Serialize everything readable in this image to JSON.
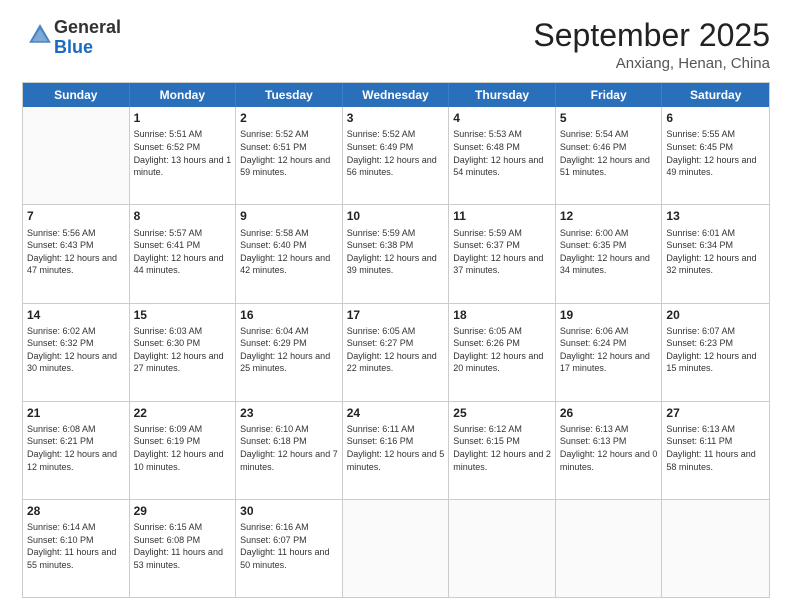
{
  "header": {
    "logo": {
      "line1": "General",
      "line2": "Blue"
    },
    "title": "September 2025",
    "subtitle": "Anxiang, Henan, China"
  },
  "weekdays": [
    "Sunday",
    "Monday",
    "Tuesday",
    "Wednesday",
    "Thursday",
    "Friday",
    "Saturday"
  ],
  "rows": [
    [
      {
        "day": "",
        "empty": true
      },
      {
        "day": "1",
        "sunrise": "Sunrise: 5:51 AM",
        "sunset": "Sunset: 6:52 PM",
        "daylight": "Daylight: 13 hours and 1 minute."
      },
      {
        "day": "2",
        "sunrise": "Sunrise: 5:52 AM",
        "sunset": "Sunset: 6:51 PM",
        "daylight": "Daylight: 12 hours and 59 minutes."
      },
      {
        "day": "3",
        "sunrise": "Sunrise: 5:52 AM",
        "sunset": "Sunset: 6:49 PM",
        "daylight": "Daylight: 12 hours and 56 minutes."
      },
      {
        "day": "4",
        "sunrise": "Sunrise: 5:53 AM",
        "sunset": "Sunset: 6:48 PM",
        "daylight": "Daylight: 12 hours and 54 minutes."
      },
      {
        "day": "5",
        "sunrise": "Sunrise: 5:54 AM",
        "sunset": "Sunset: 6:46 PM",
        "daylight": "Daylight: 12 hours and 51 minutes."
      },
      {
        "day": "6",
        "sunrise": "Sunrise: 5:55 AM",
        "sunset": "Sunset: 6:45 PM",
        "daylight": "Daylight: 12 hours and 49 minutes."
      }
    ],
    [
      {
        "day": "7",
        "sunrise": "Sunrise: 5:56 AM",
        "sunset": "Sunset: 6:43 PM",
        "daylight": "Daylight: 12 hours and 47 minutes."
      },
      {
        "day": "8",
        "sunrise": "Sunrise: 5:57 AM",
        "sunset": "Sunset: 6:41 PM",
        "daylight": "Daylight: 12 hours and 44 minutes."
      },
      {
        "day": "9",
        "sunrise": "Sunrise: 5:58 AM",
        "sunset": "Sunset: 6:40 PM",
        "daylight": "Daylight: 12 hours and 42 minutes."
      },
      {
        "day": "10",
        "sunrise": "Sunrise: 5:59 AM",
        "sunset": "Sunset: 6:38 PM",
        "daylight": "Daylight: 12 hours and 39 minutes."
      },
      {
        "day": "11",
        "sunrise": "Sunrise: 5:59 AM",
        "sunset": "Sunset: 6:37 PM",
        "daylight": "Daylight: 12 hours and 37 minutes."
      },
      {
        "day": "12",
        "sunrise": "Sunrise: 6:00 AM",
        "sunset": "Sunset: 6:35 PM",
        "daylight": "Daylight: 12 hours and 34 minutes."
      },
      {
        "day": "13",
        "sunrise": "Sunrise: 6:01 AM",
        "sunset": "Sunset: 6:34 PM",
        "daylight": "Daylight: 12 hours and 32 minutes."
      }
    ],
    [
      {
        "day": "14",
        "sunrise": "Sunrise: 6:02 AM",
        "sunset": "Sunset: 6:32 PM",
        "daylight": "Daylight: 12 hours and 30 minutes."
      },
      {
        "day": "15",
        "sunrise": "Sunrise: 6:03 AM",
        "sunset": "Sunset: 6:30 PM",
        "daylight": "Daylight: 12 hours and 27 minutes."
      },
      {
        "day": "16",
        "sunrise": "Sunrise: 6:04 AM",
        "sunset": "Sunset: 6:29 PM",
        "daylight": "Daylight: 12 hours and 25 minutes."
      },
      {
        "day": "17",
        "sunrise": "Sunrise: 6:05 AM",
        "sunset": "Sunset: 6:27 PM",
        "daylight": "Daylight: 12 hours and 22 minutes."
      },
      {
        "day": "18",
        "sunrise": "Sunrise: 6:05 AM",
        "sunset": "Sunset: 6:26 PM",
        "daylight": "Daylight: 12 hours and 20 minutes."
      },
      {
        "day": "19",
        "sunrise": "Sunrise: 6:06 AM",
        "sunset": "Sunset: 6:24 PM",
        "daylight": "Daylight: 12 hours and 17 minutes."
      },
      {
        "day": "20",
        "sunrise": "Sunrise: 6:07 AM",
        "sunset": "Sunset: 6:23 PM",
        "daylight": "Daylight: 12 hours and 15 minutes."
      }
    ],
    [
      {
        "day": "21",
        "sunrise": "Sunrise: 6:08 AM",
        "sunset": "Sunset: 6:21 PM",
        "daylight": "Daylight: 12 hours and 12 minutes."
      },
      {
        "day": "22",
        "sunrise": "Sunrise: 6:09 AM",
        "sunset": "Sunset: 6:19 PM",
        "daylight": "Daylight: 12 hours and 10 minutes."
      },
      {
        "day": "23",
        "sunrise": "Sunrise: 6:10 AM",
        "sunset": "Sunset: 6:18 PM",
        "daylight": "Daylight: 12 hours and 7 minutes."
      },
      {
        "day": "24",
        "sunrise": "Sunrise: 6:11 AM",
        "sunset": "Sunset: 6:16 PM",
        "daylight": "Daylight: 12 hours and 5 minutes."
      },
      {
        "day": "25",
        "sunrise": "Sunrise: 6:12 AM",
        "sunset": "Sunset: 6:15 PM",
        "daylight": "Daylight: 12 hours and 2 minutes."
      },
      {
        "day": "26",
        "sunrise": "Sunrise: 6:13 AM",
        "sunset": "Sunset: 6:13 PM",
        "daylight": "Daylight: 12 hours and 0 minutes."
      },
      {
        "day": "27",
        "sunrise": "Sunrise: 6:13 AM",
        "sunset": "Sunset: 6:11 PM",
        "daylight": "Daylight: 11 hours and 58 minutes."
      }
    ],
    [
      {
        "day": "28",
        "sunrise": "Sunrise: 6:14 AM",
        "sunset": "Sunset: 6:10 PM",
        "daylight": "Daylight: 11 hours and 55 minutes."
      },
      {
        "day": "29",
        "sunrise": "Sunrise: 6:15 AM",
        "sunset": "Sunset: 6:08 PM",
        "daylight": "Daylight: 11 hours and 53 minutes."
      },
      {
        "day": "30",
        "sunrise": "Sunrise: 6:16 AM",
        "sunset": "Sunset: 6:07 PM",
        "daylight": "Daylight: 11 hours and 50 minutes."
      },
      {
        "day": "",
        "empty": true
      },
      {
        "day": "",
        "empty": true
      },
      {
        "day": "",
        "empty": true
      },
      {
        "day": "",
        "empty": true
      }
    ]
  ]
}
